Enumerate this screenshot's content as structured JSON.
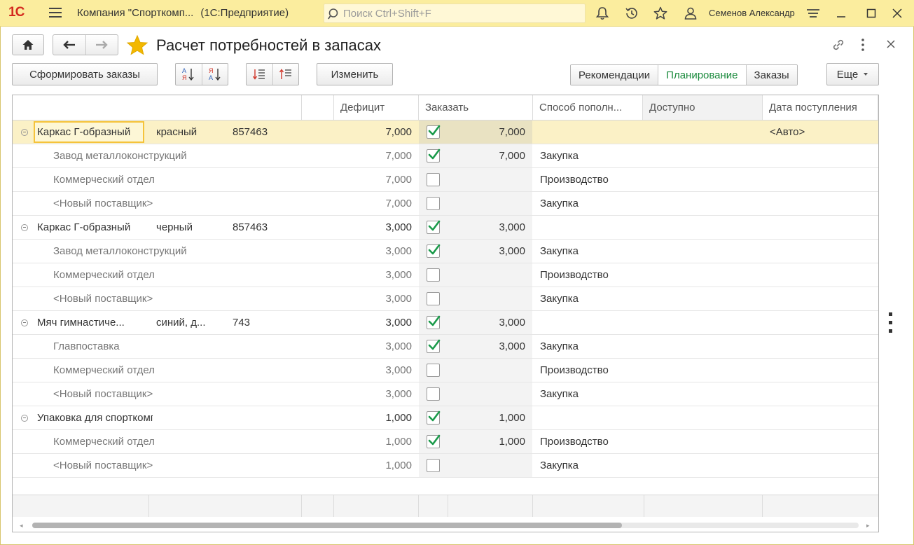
{
  "app": {
    "logo": "1С",
    "title": "Компания \"Спорткомп...",
    "subtitle": "(1С:Предприятие)",
    "search_placeholder": "Поиск Ctrl+Shift+F",
    "user": "Семенов Александр"
  },
  "form": {
    "title": "Расчет потребностей в запасах",
    "buttons": {
      "create_orders": "Сформировать заказы",
      "edit": "Изменить",
      "more": "Еще"
    },
    "segments": [
      {
        "label": "Рекомендации",
        "active": false
      },
      {
        "label": "Планирование",
        "active": true
      },
      {
        "label": "Заказы",
        "active": false
      }
    ]
  },
  "grid": {
    "columns": [
      "",
      "",
      "",
      "",
      "Дефицит",
      "Заказать",
      "Способ пополн...",
      "Доступно",
      "Дата поступления"
    ],
    "rows": [
      {
        "type": "parent",
        "name": "Каркас Г-образный",
        "char": "красный",
        "code": "857463",
        "deficit": "7,000",
        "checked": true,
        "order": "7,000",
        "method": "",
        "date": "<Авто>",
        "selected": true
      },
      {
        "type": "child",
        "name": "Завод металлоконструкций",
        "deficit": "7,000",
        "checked": true,
        "order": "7,000",
        "method": "Закупка"
      },
      {
        "type": "child",
        "name": "Коммерческий отдел",
        "deficit": "7,000",
        "checked": false,
        "order": "",
        "method": "Производство"
      },
      {
        "type": "child",
        "name": "<Новый поставщик>",
        "deficit": "7,000",
        "checked": false,
        "order": "",
        "method": "Закупка"
      },
      {
        "type": "parent",
        "name": "Каркас Г-образный",
        "char": "черный",
        "code": "857463",
        "deficit": "3,000",
        "checked": true,
        "order": "3,000",
        "method": ""
      },
      {
        "type": "child",
        "name": "Завод металлоконструкций",
        "deficit": "3,000",
        "checked": true,
        "order": "3,000",
        "method": "Закупка"
      },
      {
        "type": "child",
        "name": "Коммерческий отдел",
        "deficit": "3,000",
        "checked": false,
        "order": "",
        "method": "Производство"
      },
      {
        "type": "child",
        "name": "<Новый поставщик>",
        "deficit": "3,000",
        "checked": false,
        "order": "",
        "method": "Закупка"
      },
      {
        "type": "parent",
        "name": "Мяч гимнастиче...",
        "char": "синий, д...",
        "code": "743",
        "deficit": "3,000",
        "checked": true,
        "order": "3,000",
        "method": ""
      },
      {
        "type": "child",
        "name": "Главпоставка",
        "deficit": "3,000",
        "checked": true,
        "order": "3,000",
        "method": "Закупка"
      },
      {
        "type": "child",
        "name": "Коммерческий отдел",
        "deficit": "3,000",
        "checked": false,
        "order": "",
        "method": "Производство"
      },
      {
        "type": "child",
        "name": "<Новый поставщик>",
        "deficit": "3,000",
        "checked": false,
        "order": "",
        "method": "Закупка"
      },
      {
        "type": "parent",
        "name": "Упаковка для спорткомплекса",
        "char": "",
        "code": "",
        "deficit": "1,000",
        "checked": true,
        "order": "1,000",
        "method": ""
      },
      {
        "type": "child",
        "name": "Коммерческий отдел",
        "deficit": "1,000",
        "checked": true,
        "order": "1,000",
        "method": "Производство"
      },
      {
        "type": "child",
        "name": "<Новый поставщик>",
        "deficit": "1,000",
        "checked": false,
        "order": "",
        "method": "Закупка"
      }
    ]
  },
  "colors": {
    "appbar": "#fbed9e",
    "accent_green": "#1a8a3c",
    "selected_row": "#fbf1c6",
    "focus_border": "#f5c33b",
    "star": "#f3b800"
  }
}
